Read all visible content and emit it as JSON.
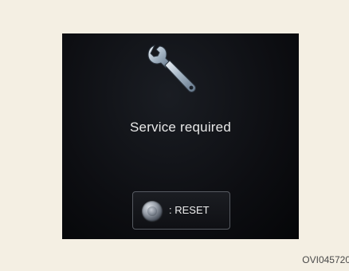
{
  "display": {
    "icon": "wrench-icon",
    "message": "Service required",
    "reset_button": {
      "icon": "knob-icon",
      "label": ": RESET"
    }
  },
  "figure_code": "OVI045720"
}
